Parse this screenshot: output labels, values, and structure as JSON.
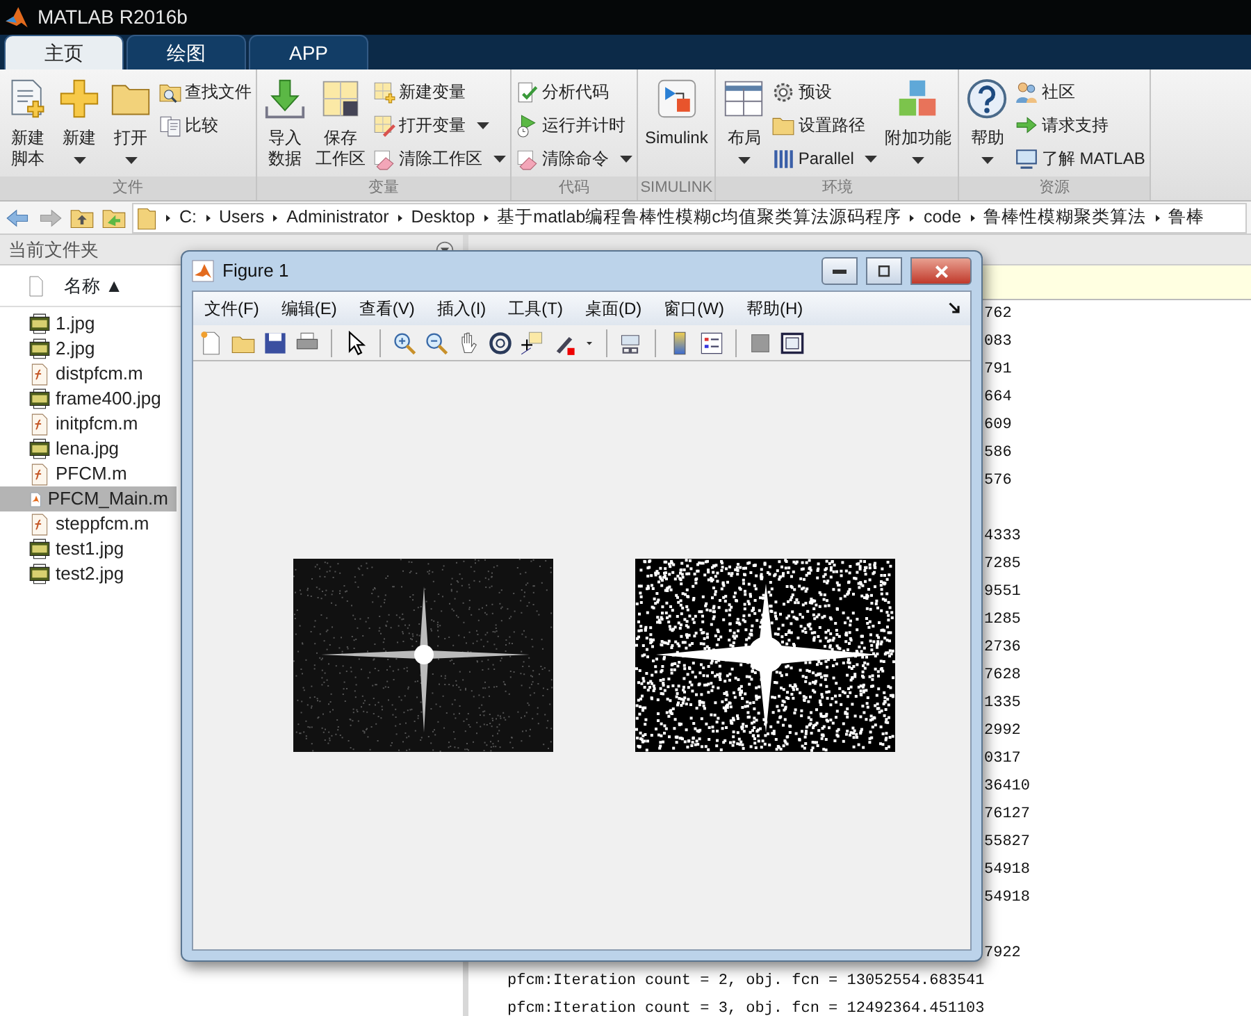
{
  "window": {
    "title": "MATLAB R2016b"
  },
  "tabs": [
    {
      "label": "主页",
      "selected": true
    },
    {
      "label": "绘图",
      "selected": false
    },
    {
      "label": "APP",
      "selected": false
    }
  ],
  "toolstrip": [
    {
      "label": "文件",
      "items": [
        {
          "kind": "large",
          "lines": [
            "新建",
            "脚本"
          ],
          "dropdown": false
        },
        {
          "kind": "large",
          "lines": [
            "新建"
          ],
          "dropdown": true
        },
        {
          "kind": "large",
          "lines": [
            "打开"
          ],
          "dropdown": true
        },
        {
          "kind": "stack",
          "items": [
            {
              "label": "查找文件",
              "dropdown": false
            },
            {
              "label": "比较",
              "dropdown": false
            }
          ]
        }
      ]
    },
    {
      "label": "变量",
      "items": [
        {
          "kind": "large",
          "lines": [
            "导入",
            "数据"
          ],
          "dropdown": false
        },
        {
          "kind": "large",
          "lines": [
            "保存",
            "工作区"
          ],
          "dropdown": false
        },
        {
          "kind": "stack",
          "items": [
            {
              "label": "新建变量",
              "dropdown": false
            },
            {
              "label": "打开变量",
              "dropdown": true
            },
            {
              "label": "清除工作区",
              "dropdown": true
            }
          ]
        }
      ]
    },
    {
      "label": "代码",
      "items": [
        {
          "kind": "stack",
          "items": [
            {
              "label": "分析代码",
              "dropdown": false
            },
            {
              "label": "运行并计时",
              "dropdown": false
            },
            {
              "label": "清除命令",
              "dropdown": true
            }
          ]
        }
      ]
    },
    {
      "label": "SIMULINK",
      "items": [
        {
          "kind": "large",
          "lines": [
            "Simulink"
          ],
          "dropdown": false
        }
      ]
    },
    {
      "label": "环境",
      "items": [
        {
          "kind": "large",
          "lines": [
            "布局"
          ],
          "dropdown": true
        },
        {
          "kind": "stack",
          "items": [
            {
              "label": "预设",
              "dropdown": false
            },
            {
              "label": "设置路径",
              "dropdown": false
            },
            {
              "label": "Parallel",
              "dropdown": true
            }
          ]
        },
        {
          "kind": "large",
          "lines": [
            "附加功能"
          ],
          "dropdown": true
        }
      ]
    },
    {
      "label": "资源",
      "items": [
        {
          "kind": "large",
          "lines": [
            "帮助"
          ],
          "dropdown": true
        },
        {
          "kind": "stack",
          "items": [
            {
              "label": "社区",
              "dropdown": false
            },
            {
              "label": "请求支持",
              "dropdown": false
            },
            {
              "label": "了解 MATLAB",
              "dropdown": false
            }
          ]
        }
      ]
    }
  ],
  "path_bar": [
    "C:",
    "Users",
    "Administrator",
    "Desktop",
    "基于matlab编程鲁棒性模糊c均值聚类算法源码程序",
    "code",
    "鲁棒性模糊聚类算法",
    "鲁棒"
  ],
  "current_folder": {
    "title": "当前文件夹",
    "column": "名称 ▲",
    "files": [
      {
        "name": "1.jpg",
        "kind": "image",
        "selected": false
      },
      {
        "name": "2.jpg",
        "kind": "image",
        "selected": false
      },
      {
        "name": "distpfcm.m",
        "kind": "function",
        "selected": false
      },
      {
        "name": "frame400.jpg",
        "kind": "image",
        "selected": false
      },
      {
        "name": "initpfcm.m",
        "kind": "function",
        "selected": false
      },
      {
        "name": "lena.jpg",
        "kind": "image",
        "selected": false
      },
      {
        "name": "PFCM.m",
        "kind": "function",
        "selected": false
      },
      {
        "name": "PFCM_Main.m",
        "kind": "script",
        "selected": true
      },
      {
        "name": "steppfcm.m",
        "kind": "function",
        "selected": false
      },
      {
        "name": "test1.jpg",
        "kind": "image",
        "selected": false
      },
      {
        "name": "test2.jpg",
        "kind": "image",
        "selected": false
      }
    ]
  },
  "command_window": {
    "lines": [
      {
        "kind": "partial",
        "text": "762"
      },
      {
        "kind": "partial",
        "text": "083"
      },
      {
        "kind": "partial",
        "text": "791"
      },
      {
        "kind": "partial",
        "text": "664"
      },
      {
        "kind": "partial",
        "text": "609"
      },
      {
        "kind": "partial",
        "text": "586"
      },
      {
        "kind": "partial",
        "text": "576"
      },
      {
        "kind": "blank"
      },
      {
        "kind": "partial",
        "text": "4333"
      },
      {
        "kind": "partial",
        "text": "7285"
      },
      {
        "kind": "partial",
        "text": "9551"
      },
      {
        "kind": "partial",
        "text": "1285"
      },
      {
        "kind": "partial",
        "text": "2736"
      },
      {
        "kind": "partial",
        "text": "7628"
      },
      {
        "kind": "partial",
        "text": "1335"
      },
      {
        "kind": "partial",
        "text": "2992"
      },
      {
        "kind": "partial",
        "text": "0317"
      },
      {
        "kind": "partial",
        "text": "36410"
      },
      {
        "kind": "partial",
        "text": "76127"
      },
      {
        "kind": "partial",
        "text": "55827"
      },
      {
        "kind": "partial",
        "text": "54918"
      },
      {
        "kind": "partial",
        "text": "54918"
      },
      {
        "kind": "blank"
      },
      {
        "kind": "partial",
        "text": "7922"
      },
      {
        "kind": "full",
        "text": "pfcm:Iteration count = 2, obj. fcn = 13052554.683541"
      },
      {
        "kind": "full",
        "text": "pfcm:Iteration count = 3, obj. fcn = 12492364.451103"
      }
    ]
  },
  "figure_window": {
    "title": "Figure 1",
    "menu": [
      "文件(F)",
      "编辑(E)",
      "查看(V)",
      "插入(I)",
      "工具(T)",
      "桌面(D)",
      "窗口(W)",
      "帮助(H)"
    ],
    "images": [
      {
        "kind": "grayscale"
      },
      {
        "kind": "binary"
      }
    ]
  }
}
